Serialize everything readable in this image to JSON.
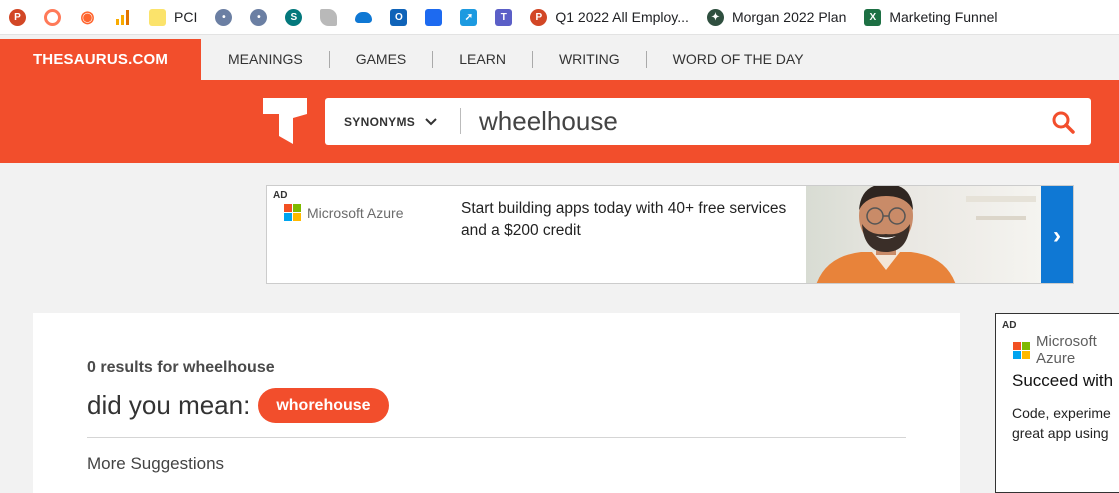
{
  "bookmarks": [
    {
      "icon": "powerpoint-icon",
      "label": ""
    },
    {
      "icon": "hubspot-icon",
      "label": ""
    },
    {
      "icon": "semrush-icon",
      "label": ""
    },
    {
      "icon": "analytics-bars-icon",
      "label": ""
    },
    {
      "icon": "note-icon",
      "label": "PCI"
    },
    {
      "icon": "bot-icon",
      "label": ""
    },
    {
      "icon": "bot-icon",
      "label": ""
    },
    {
      "icon": "sharepoint-icon",
      "label": ""
    },
    {
      "icon": "leaf-icon",
      "label": ""
    },
    {
      "icon": "onedrive-icon",
      "label": ""
    },
    {
      "icon": "outlook-icon",
      "label": ""
    },
    {
      "icon": "planner-icon",
      "label": ""
    },
    {
      "icon": "arrow-app-icon",
      "label": ""
    },
    {
      "icon": "teams-icon",
      "label": ""
    },
    {
      "icon": "powerpoint-icon",
      "label": "Q1 2022 All Employ..."
    },
    {
      "icon": "compass-icon",
      "label": "Morgan 2022 Plan"
    },
    {
      "icon": "excel-icon",
      "label": "Marketing Funnel"
    }
  ],
  "site": {
    "logo": "THESAURUS.COM",
    "nav": [
      "MEANINGS",
      "GAMES",
      "LEARN",
      "WRITING",
      "WORD OF THE DAY"
    ]
  },
  "search": {
    "mode": "SYNONYMS",
    "query": "wheelhouse",
    "search_icon": "search-icon"
  },
  "ad_banner": {
    "tag": "AD",
    "brand": "Microsoft Azure",
    "text": "Start building apps today with 40+ free services and a $200 credit",
    "arrow": "›"
  },
  "results": {
    "summary": "0 results for wheelhouse",
    "did_you_mean_label": "did you mean:",
    "suggestion": "whorehouse",
    "more_label": "More Suggestions"
  },
  "ad_side": {
    "tag": "AD",
    "brand": "Microsoft Azure",
    "headline": "Succeed with",
    "body_line1": "Code, experime",
    "body_line2": "great app using"
  },
  "colors": {
    "brand_orange": "#f24e2c",
    "azure_blue": "#0f78d4"
  }
}
